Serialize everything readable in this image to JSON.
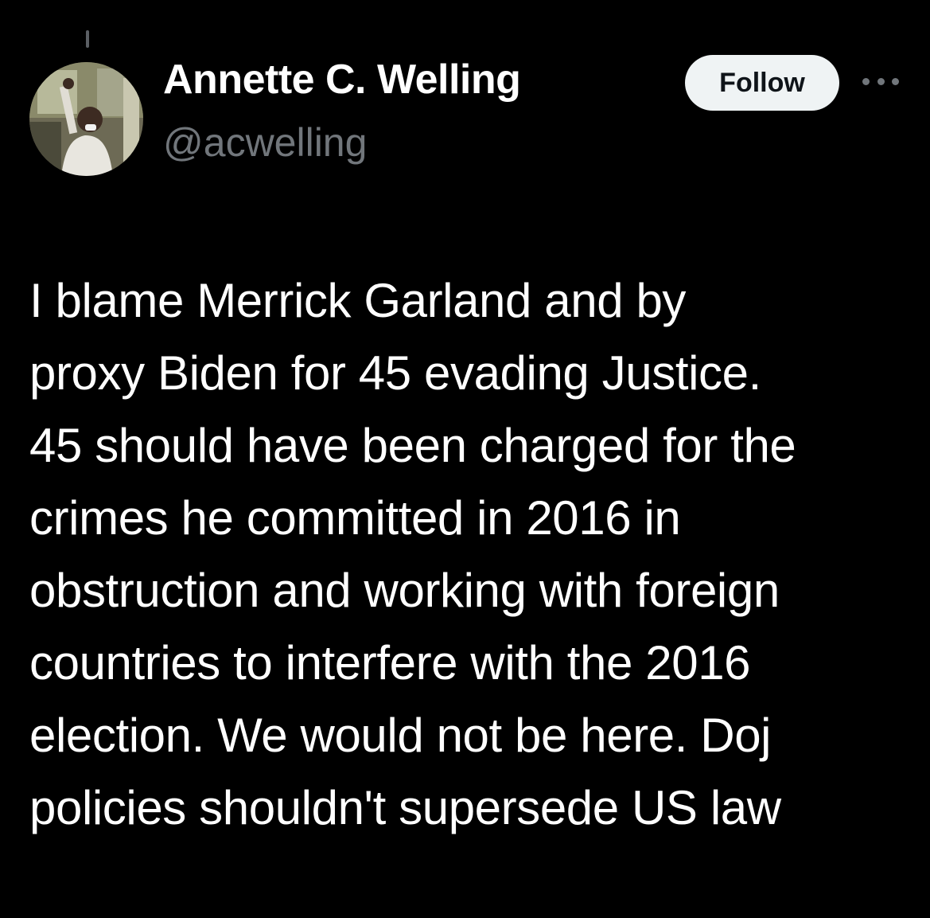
{
  "author": {
    "display_name": "Annette C. Welling",
    "handle": "@acwelling",
    "avatar_icon": "profile-photo"
  },
  "actions": {
    "follow_label": "Follow",
    "more_icon": "more-horizontal-icon"
  },
  "tweet": {
    "lines": [
      "I blame Merrick Garland and by",
      "proxy Biden for 45 evading Justice.",
      "45 should have been charged for the",
      "crimes he committed in 2016 in",
      "obstruction and working with foreign",
      "countries to interfere with the 2016",
      "election. We would not be here. Doj",
      "policies shouldn't supersede US law"
    ]
  },
  "colors": {
    "background": "#000000",
    "text_primary": "#ffffff",
    "text_secondary": "#71767b",
    "follow_bg": "#eff3f4",
    "follow_text": "#0f1419"
  }
}
